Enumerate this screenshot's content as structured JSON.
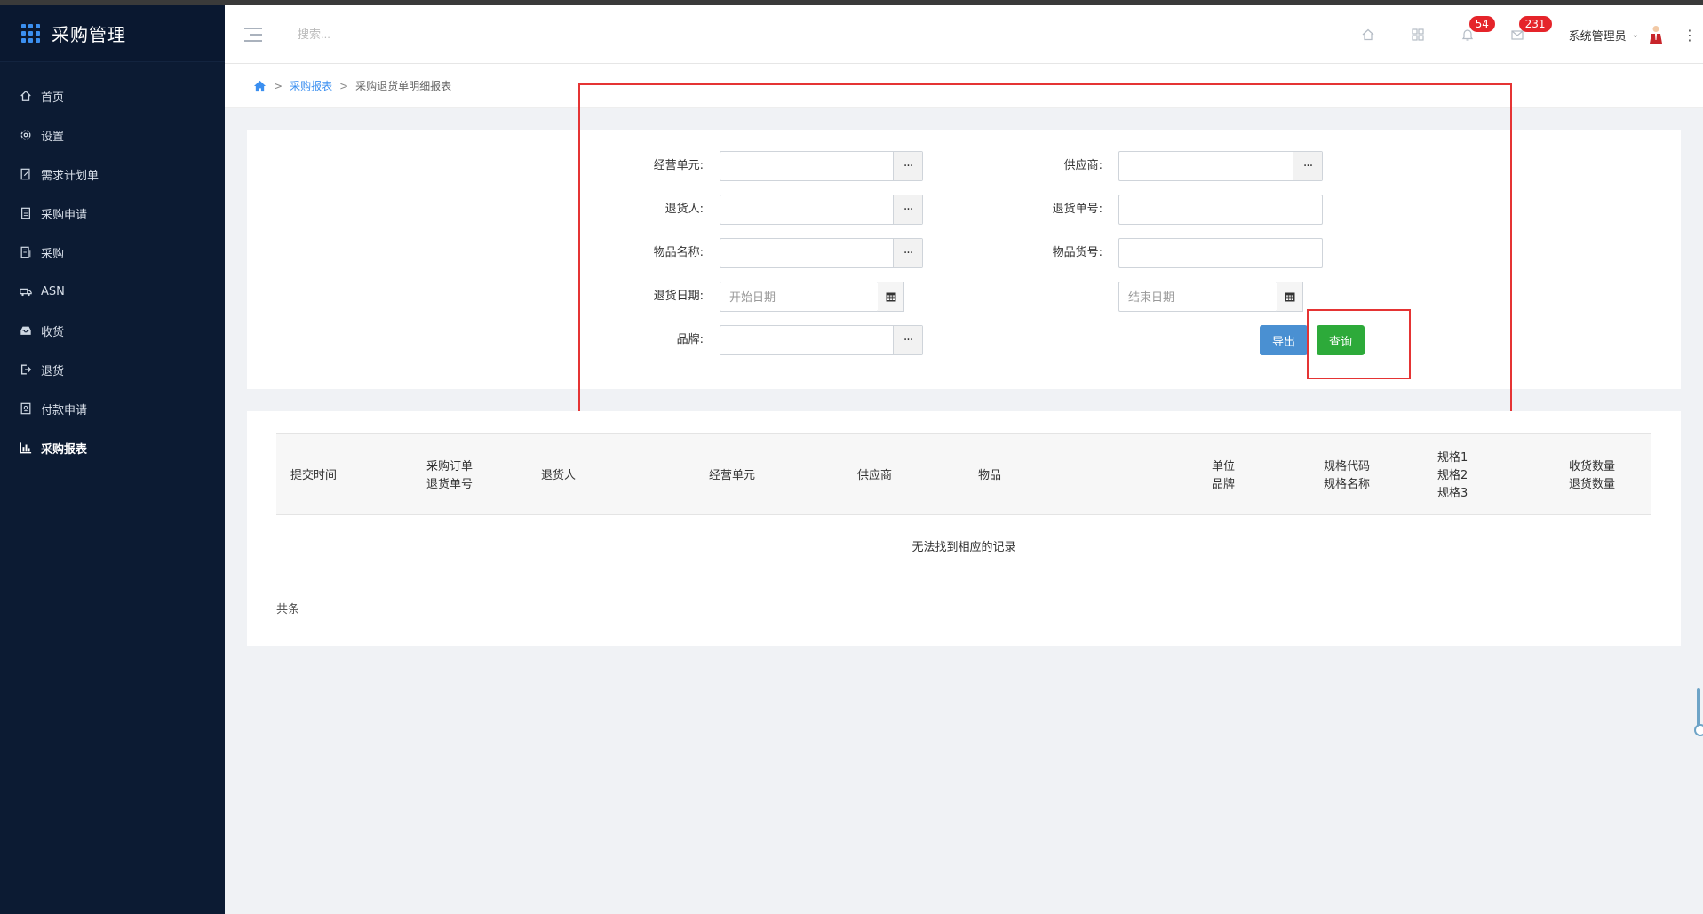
{
  "app": {
    "title": "采购管理"
  },
  "sidebar": {
    "items": [
      {
        "label": "首页",
        "icon": "home-icon"
      },
      {
        "label": "设置",
        "icon": "gear-icon"
      },
      {
        "label": "需求计划单",
        "icon": "edit-doc-icon"
      },
      {
        "label": "采购申请",
        "icon": "doc-icon"
      },
      {
        "label": "采购",
        "icon": "list-doc-icon"
      },
      {
        "label": "ASN",
        "icon": "truck-icon"
      },
      {
        "label": "收货",
        "icon": "inbox-icon"
      },
      {
        "label": "退货",
        "icon": "sign-out-icon"
      },
      {
        "label": "付款申请",
        "icon": "payment-doc-icon"
      },
      {
        "label": "采购报表",
        "icon": "bar-chart-icon",
        "active": true
      }
    ]
  },
  "header": {
    "search_placeholder": "搜索...",
    "notifications_count": "54",
    "messages_count": "231",
    "user_name": "系统管理员"
  },
  "breadcrumb": {
    "parent": "采购报表",
    "current": "采购退货单明细报表"
  },
  "form": {
    "business_unit_label": "经营单元:",
    "supplier_label": "供应商:",
    "returner_label": "退货人:",
    "return_no_label": "退货单号:",
    "item_name_label": "物品名称:",
    "item_code_label": "物品货号:",
    "return_date_label": "退货日期:",
    "start_date_placeholder": "开始日期",
    "end_date_placeholder": "结束日期",
    "brand_label": "品牌:",
    "picker_glyph": "···",
    "export_button": "导出",
    "query_button": "查询"
  },
  "table": {
    "columns": [
      {
        "lines": [
          "提交时间"
        ]
      },
      {
        "lines": [
          "采购订单",
          "退货单号"
        ]
      },
      {
        "lines": [
          "退货人"
        ]
      },
      {
        "lines": [
          "经营单元"
        ]
      },
      {
        "lines": [
          "供应商"
        ]
      },
      {
        "lines": [
          "物品"
        ]
      },
      {
        "lines": [
          "单位",
          "品牌"
        ]
      },
      {
        "lines": [
          "规格代码",
          "规格名称"
        ]
      },
      {
        "lines": [
          "规格1",
          "规格2",
          "规格3"
        ]
      },
      {
        "lines": [
          "收货数量",
          "退货数量"
        ]
      }
    ],
    "empty_text": "无法找到相应的记录",
    "total_text": "共条"
  },
  "colors": {
    "sidebar_bg": "#0c1b33",
    "accent": "#3b8ff0",
    "export_button": "#4a90d2",
    "query_button": "#2daa3a",
    "badge": "#e5242a",
    "annotation": "#e53434"
  }
}
